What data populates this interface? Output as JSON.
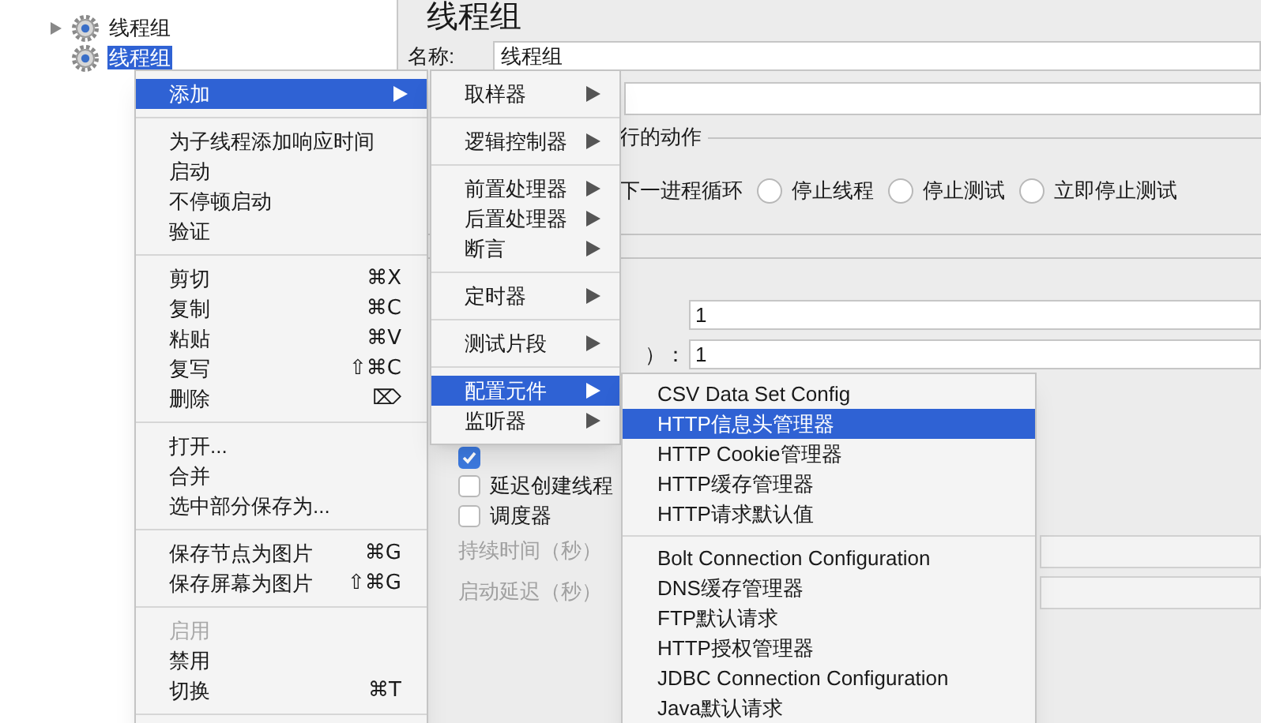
{
  "tree": {
    "children": [
      {
        "label": "线程组",
        "expander": true,
        "selected": false
      },
      {
        "label": "线程组",
        "expander": false,
        "selected": true
      }
    ]
  },
  "editor": {
    "title": "线程组",
    "name_label": "名称:",
    "name_value": "线程组",
    "error_action_legend": "行的动作",
    "continue_label": "下一进程循环",
    "radios": [
      {
        "label": "停止线程",
        "selected": false
      },
      {
        "label": "停止测试",
        "selected": false
      },
      {
        "label": "立即停止测试",
        "selected": false
      }
    ],
    "thread_fields": [
      {
        "value": "1"
      },
      {
        "label": "）：",
        "value": "1"
      }
    ],
    "checkboxes": [
      {
        "checked": true
      },
      {
        "label": "延迟创建线程",
        "checked": false
      },
      {
        "label": "调度器",
        "checked": false
      }
    ],
    "scheduler_fields": [
      {
        "label": "持续时间（秒）",
        "disabled": true
      },
      {
        "label": "启动延迟（秒）",
        "disabled": true
      }
    ]
  },
  "context_menu": {
    "items": [
      {
        "kind": "item",
        "label": "添加",
        "submenu": true,
        "selected": true,
        "disabled": false
      },
      {
        "kind": "separator"
      },
      {
        "kind": "item",
        "label": "为子线程添加响应时间",
        "submenu": false,
        "selected": false,
        "disabled": false
      },
      {
        "kind": "item",
        "label": "启动",
        "submenu": false,
        "selected": false,
        "disabled": false
      },
      {
        "kind": "item",
        "label": "不停顿启动",
        "submenu": false,
        "selected": false,
        "disabled": false
      },
      {
        "kind": "item",
        "label": "验证",
        "submenu": false,
        "selected": false,
        "disabled": false
      },
      {
        "kind": "separator"
      },
      {
        "kind": "item",
        "label": "剪切",
        "shortcut": "⌘X",
        "submenu": false,
        "selected": false,
        "disabled": false
      },
      {
        "kind": "item",
        "label": "复制",
        "shortcut": "⌘C",
        "submenu": false,
        "selected": false,
        "disabled": false
      },
      {
        "kind": "item",
        "label": "粘贴",
        "shortcut": "⌘V",
        "submenu": false,
        "selected": false,
        "disabled": false
      },
      {
        "kind": "item",
        "label": "复写",
        "shortcut": "⇧⌘C",
        "submenu": false,
        "selected": false,
        "disabled": false
      },
      {
        "kind": "item",
        "label": "删除",
        "shortcut": "⌦",
        "submenu": false,
        "selected": false,
        "disabled": false
      },
      {
        "kind": "separator"
      },
      {
        "kind": "item",
        "label": "打开...",
        "submenu": false,
        "selected": false,
        "disabled": false
      },
      {
        "kind": "item",
        "label": "合并",
        "submenu": false,
        "selected": false,
        "disabled": false
      },
      {
        "kind": "item",
        "label": "选中部分保存为...",
        "submenu": false,
        "selected": false,
        "disabled": false
      },
      {
        "kind": "separator"
      },
      {
        "kind": "item",
        "label": "保存节点为图片",
        "shortcut": "⌘G",
        "submenu": false,
        "selected": false,
        "disabled": false
      },
      {
        "kind": "item",
        "label": "保存屏幕为图片",
        "shortcut": "⇧⌘G",
        "submenu": false,
        "selected": false,
        "disabled": false
      },
      {
        "kind": "separator"
      },
      {
        "kind": "item",
        "label": "启用",
        "submenu": false,
        "selected": false,
        "disabled": true
      },
      {
        "kind": "item",
        "label": "禁用",
        "submenu": false,
        "selected": false,
        "disabled": false
      },
      {
        "kind": "item",
        "label": "切换",
        "shortcut": "⌘T",
        "submenu": false,
        "selected": false,
        "disabled": false
      },
      {
        "kind": "separator"
      }
    ]
  },
  "add_submenu": {
    "items": [
      {
        "kind": "item",
        "label": "取样器",
        "submenu": true,
        "selected": false
      },
      {
        "kind": "separator"
      },
      {
        "kind": "item",
        "label": "逻辑控制器",
        "submenu": true,
        "selected": false
      },
      {
        "kind": "separator"
      },
      {
        "kind": "item",
        "label": "前置处理器",
        "submenu": true,
        "selected": false
      },
      {
        "kind": "item",
        "label": "后置处理器",
        "submenu": true,
        "selected": false
      },
      {
        "kind": "item",
        "label": "断言",
        "submenu": true,
        "selected": false
      },
      {
        "kind": "separator"
      },
      {
        "kind": "item",
        "label": "定时器",
        "submenu": true,
        "selected": false
      },
      {
        "kind": "separator"
      },
      {
        "kind": "item",
        "label": "测试片段",
        "submenu": true,
        "selected": false
      },
      {
        "kind": "separator"
      },
      {
        "kind": "item",
        "label": "配置元件",
        "submenu": true,
        "selected": true
      },
      {
        "kind": "item",
        "label": "监听器",
        "submenu": true,
        "selected": false
      }
    ]
  },
  "config_submenu": {
    "items": [
      {
        "kind": "item",
        "label": "CSV Data Set Config",
        "selected": false
      },
      {
        "kind": "item",
        "label": "HTTP信息头管理器",
        "selected": true
      },
      {
        "kind": "item",
        "label": "HTTP Cookie管理器",
        "selected": false
      },
      {
        "kind": "item",
        "label": "HTTP缓存管理器",
        "selected": false
      },
      {
        "kind": "item",
        "label": "HTTP请求默认值",
        "selected": false
      },
      {
        "kind": "separator"
      },
      {
        "kind": "item",
        "label": "Bolt Connection Configuration",
        "selected": false
      },
      {
        "kind": "item",
        "label": "DNS缓存管理器",
        "selected": false
      },
      {
        "kind": "item",
        "label": "FTP默认请求",
        "selected": false
      },
      {
        "kind": "item",
        "label": "HTTP授权管理器",
        "selected": false
      },
      {
        "kind": "item",
        "label": "JDBC Connection Configuration",
        "selected": false
      },
      {
        "kind": "item",
        "label": "Java默认请求",
        "selected": false
      }
    ]
  }
}
